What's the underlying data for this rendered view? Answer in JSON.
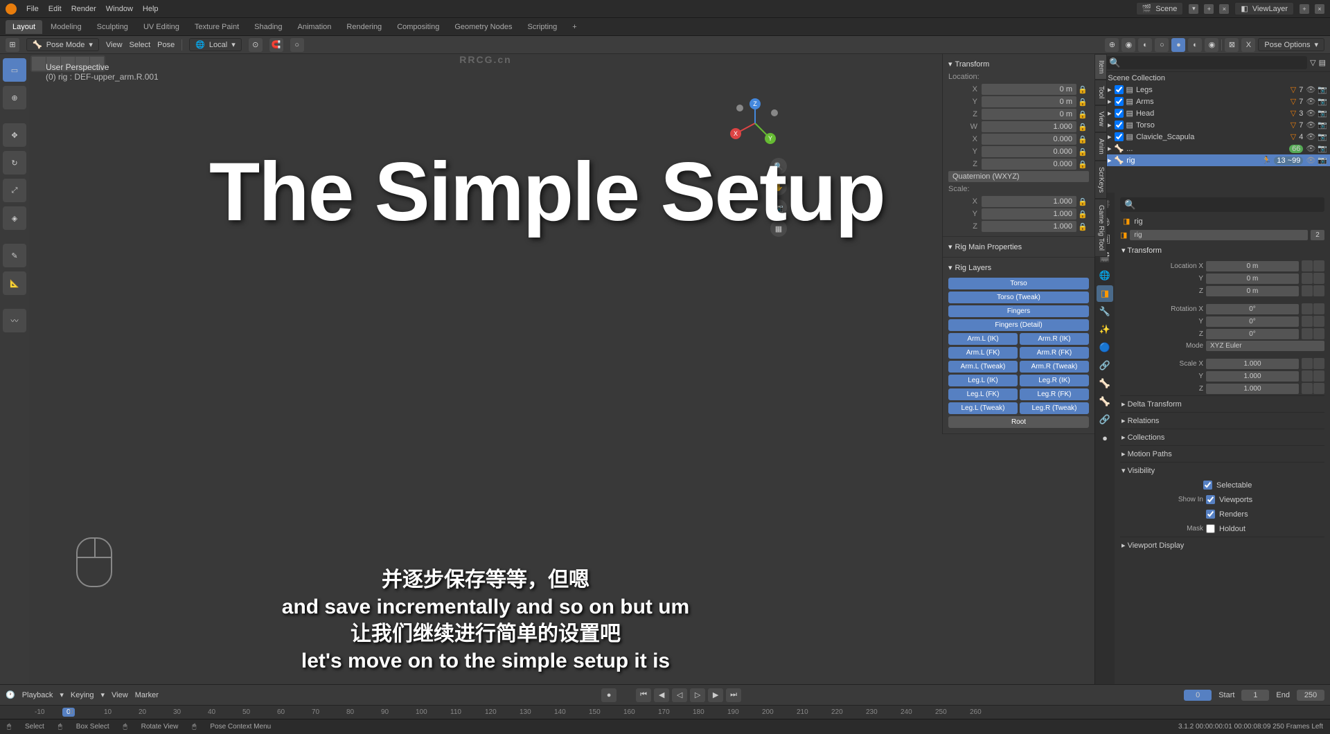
{
  "watermark_top": "RRCG.cn",
  "menubar": [
    "File",
    "Edit",
    "Render",
    "Window",
    "Help"
  ],
  "scene_dd": "Scene",
  "viewlayer_dd": "ViewLayer",
  "workspaces": [
    "Layout",
    "Modeling",
    "Sculpting",
    "UV Editing",
    "Texture Paint",
    "Shading",
    "Animation",
    "Rendering",
    "Compositing",
    "Geometry Nodes",
    "Scripting"
  ],
  "active_workspace": "Layout",
  "toolbar": {
    "mode": "Pose Mode",
    "menus": [
      "View",
      "Select",
      "Pose"
    ],
    "orient": "Local",
    "pose_options": "Pose Options"
  },
  "viewport": {
    "perspective": "User Perspective",
    "object": "(0) rig : DEF-upper_arm.R.001",
    "big_title": "The Simple Setup",
    "sub1": "并逐步保存等等，但嗯",
    "sub2": "and save incrementally and so on but um",
    "sub3": "让我们继续进行简单的设置吧",
    "sub4": "let's move on to the simple setup it is"
  },
  "vtabs": [
    "Item",
    "Tool",
    "View",
    "Anim",
    "ScrKeys",
    "Game Rig Tool"
  ],
  "npanel": {
    "transform": "Transform",
    "location": "Location:",
    "loc": {
      "x": "0 m",
      "y": "0 m",
      "z": "0 m"
    },
    "rotation_mode": "Quaternion (WXYZ)",
    "rot": {
      "w": "1.000",
      "x": "0.000",
      "y": "0.000",
      "z": "0.000"
    },
    "scale": "Scale:",
    "sc": {
      "x": "1.000",
      "y": "1.000",
      "z": "1.000"
    },
    "rig_main": "Rig Main Properties",
    "rig_layers": "Rig Layers",
    "layers": {
      "torso": "Torso",
      "torso_tweak": "Torso (Tweak)",
      "fingers": "Fingers",
      "fingers_detail": "Fingers (Detail)",
      "arml_ik": "Arm.L (IK)",
      "armr_ik": "Arm.R (IK)",
      "arml_fk": "Arm.L (FK)",
      "armr_fk": "Arm.R (FK)",
      "arml_tw": "Arm.L (Tweak)",
      "armr_tw": "Arm.R (Tweak)",
      "legl_ik": "Leg.L (IK)",
      "legr_ik": "Leg.R (IK)",
      "legl_fk": "Leg.L (FK)",
      "legr_fk": "Leg.R (FK)",
      "legl_tw": "Leg.L (Tweak)",
      "legr_tw": "Leg.R (Tweak)",
      "root": "Root"
    }
  },
  "outliner": {
    "title": "Scene Collection",
    "items": [
      {
        "name": "Legs",
        "count": "7"
      },
      {
        "name": "Arms",
        "count": "7"
      },
      {
        "name": "Head",
        "count": "3"
      },
      {
        "name": "Torso",
        "count": "7"
      },
      {
        "name": "Clavicle_Scapula",
        "count": "4"
      }
    ],
    "rig_sel": "rig",
    "rig_badge": "66",
    "rig_badge2": "13 ~99"
  },
  "props": {
    "breadcrumb_icon": "⬚",
    "breadcrumb": "rig",
    "name_field": "rig",
    "users": "2",
    "transform_hdr": "Transform",
    "loc": {
      "x": "Location X",
      "xv": "0 m",
      "y": "Y",
      "yv": "0 m",
      "z": "Z",
      "zv": "0 m"
    },
    "rot": {
      "x": "Rotation X",
      "xv": "0°",
      "y": "Y",
      "yv": "0°",
      "z": "Z",
      "zv": "0°"
    },
    "mode": "Mode",
    "mode_v": "XYZ Euler",
    "scale": {
      "x": "Scale X",
      "xv": "1.000",
      "y": "Y",
      "yv": "1.000",
      "z": "Z",
      "zv": "1.000"
    },
    "sections": [
      "Delta Transform",
      "Relations",
      "Collections",
      "Motion Paths",
      "Visibility",
      "Viewport Display"
    ],
    "visibility": {
      "selectable": "Selectable",
      "showin": "Show In",
      "viewports": "Viewports",
      "renders": "Renders",
      "mask": "Mask",
      "holdout": "Holdout"
    }
  },
  "timeline": {
    "playback": "Playback",
    "keying": "Keying",
    "view": "View",
    "marker": "Marker",
    "current": "0",
    "start_lbl": "Start",
    "start": "1",
    "end_lbl": "End",
    "end": "250"
  },
  "ruler": {
    "ticks": [
      "-10",
      "0",
      "10",
      "20",
      "30",
      "40",
      "50",
      "60",
      "70",
      "80",
      "90",
      "100",
      "110",
      "120",
      "130",
      "140",
      "150",
      "160",
      "170",
      "180",
      "190",
      "200",
      "210",
      "220",
      "230",
      "240",
      "250",
      "260"
    ],
    "cursor": "0"
  },
  "status": {
    "select": "Select",
    "box": "Box Select",
    "rotate": "Rotate View",
    "menu": "Pose Context Menu",
    "right": "3.1.2   00:00:00:01   00:00:08:09   250 Frames Left"
  }
}
